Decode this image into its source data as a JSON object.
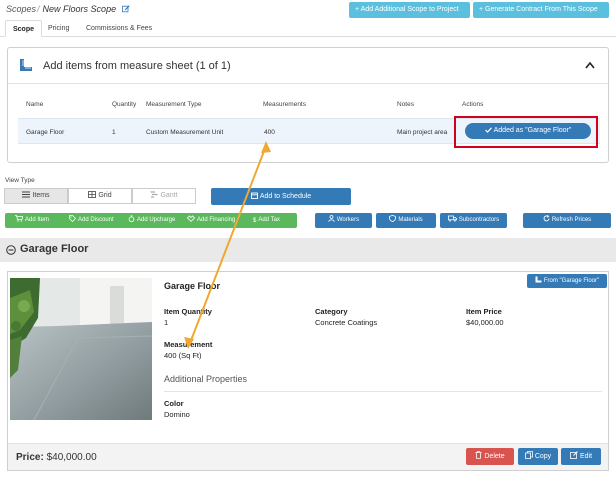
{
  "breadcrumb": {
    "root": "Scopes",
    "separator": "/",
    "current": "New Floors Scope"
  },
  "header": {
    "add_scope_label": "+ Add Additional Scope to Project",
    "generate_contract_label": "+ Generate Contract From This Scope"
  },
  "tabs": [
    {
      "label": "Scope",
      "active": true
    },
    {
      "label": "Pricing",
      "active": false
    },
    {
      "label": "Commissions & Fees",
      "active": false
    }
  ],
  "measure_panel": {
    "title": "Add items from measure sheet (1 of 1)",
    "columns": [
      "Name",
      "Quantity",
      "Measurement Type",
      "Measurements",
      "Notes",
      "Actions"
    ],
    "row": {
      "name": "Garage Floor",
      "quantity": "1",
      "measurement_type": "Custom Measurement Unit",
      "measurements": "400",
      "notes": "Main project area",
      "action_label": "Added as \"Garage Floor\""
    }
  },
  "view_type": {
    "label": "View Type",
    "options": [
      {
        "label": "Items",
        "selected": true,
        "disabled": false
      },
      {
        "label": "Grid",
        "selected": false,
        "disabled": false
      },
      {
        "label": "Gantt",
        "selected": false,
        "disabled": true
      }
    ],
    "add_to_schedule_label": "Add to Schedule"
  },
  "actions": {
    "green": [
      "Add Item",
      "Add Discount",
      "Add Upcharge",
      "Add Financing",
      "Add Tax"
    ],
    "workers_label": "Workers",
    "materials_label": "Materials",
    "subcontractors_label": "Subcontractors",
    "refresh_label": "Refresh Prices"
  },
  "section": {
    "title": "Garage Floor"
  },
  "item_card": {
    "tag": "From \"Garage Floor\"",
    "title": "Garage Floor",
    "quantity_label": "Item Quantity",
    "quantity_value": "1",
    "category_label": "Category",
    "category_value": "Concrete Coatings",
    "price_label": "Item Price",
    "price_value": "$40,000.00",
    "measurement_label": "Measurement",
    "measurement_value": "400 (Sq Ft)",
    "additional_title": "Additional Properties",
    "color_label": "Color",
    "color_value": "Domino",
    "footer_price_label": "Price:",
    "footer_price_value": "$40,000.00",
    "delete_label": "Delete",
    "copy_label": "Copy",
    "edit_label": "Edit"
  },
  "colors": {
    "primary": "#337ab7",
    "info": "#5bc0de",
    "success": "#5cb85c",
    "danger": "#d9534f",
    "highlight_border": "#d0021b",
    "annotation_arrow": "#f0a830"
  },
  "icons": [
    "edit-icon",
    "ruler-icon",
    "chevron-up-icon",
    "list-icon",
    "grid-icon",
    "gantt-icon",
    "calendar-icon",
    "user-icon",
    "shield-icon",
    "truck-icon",
    "refresh-icon",
    "minus-circle-icon",
    "trash-icon",
    "copy-icon",
    "edit-icon"
  ]
}
